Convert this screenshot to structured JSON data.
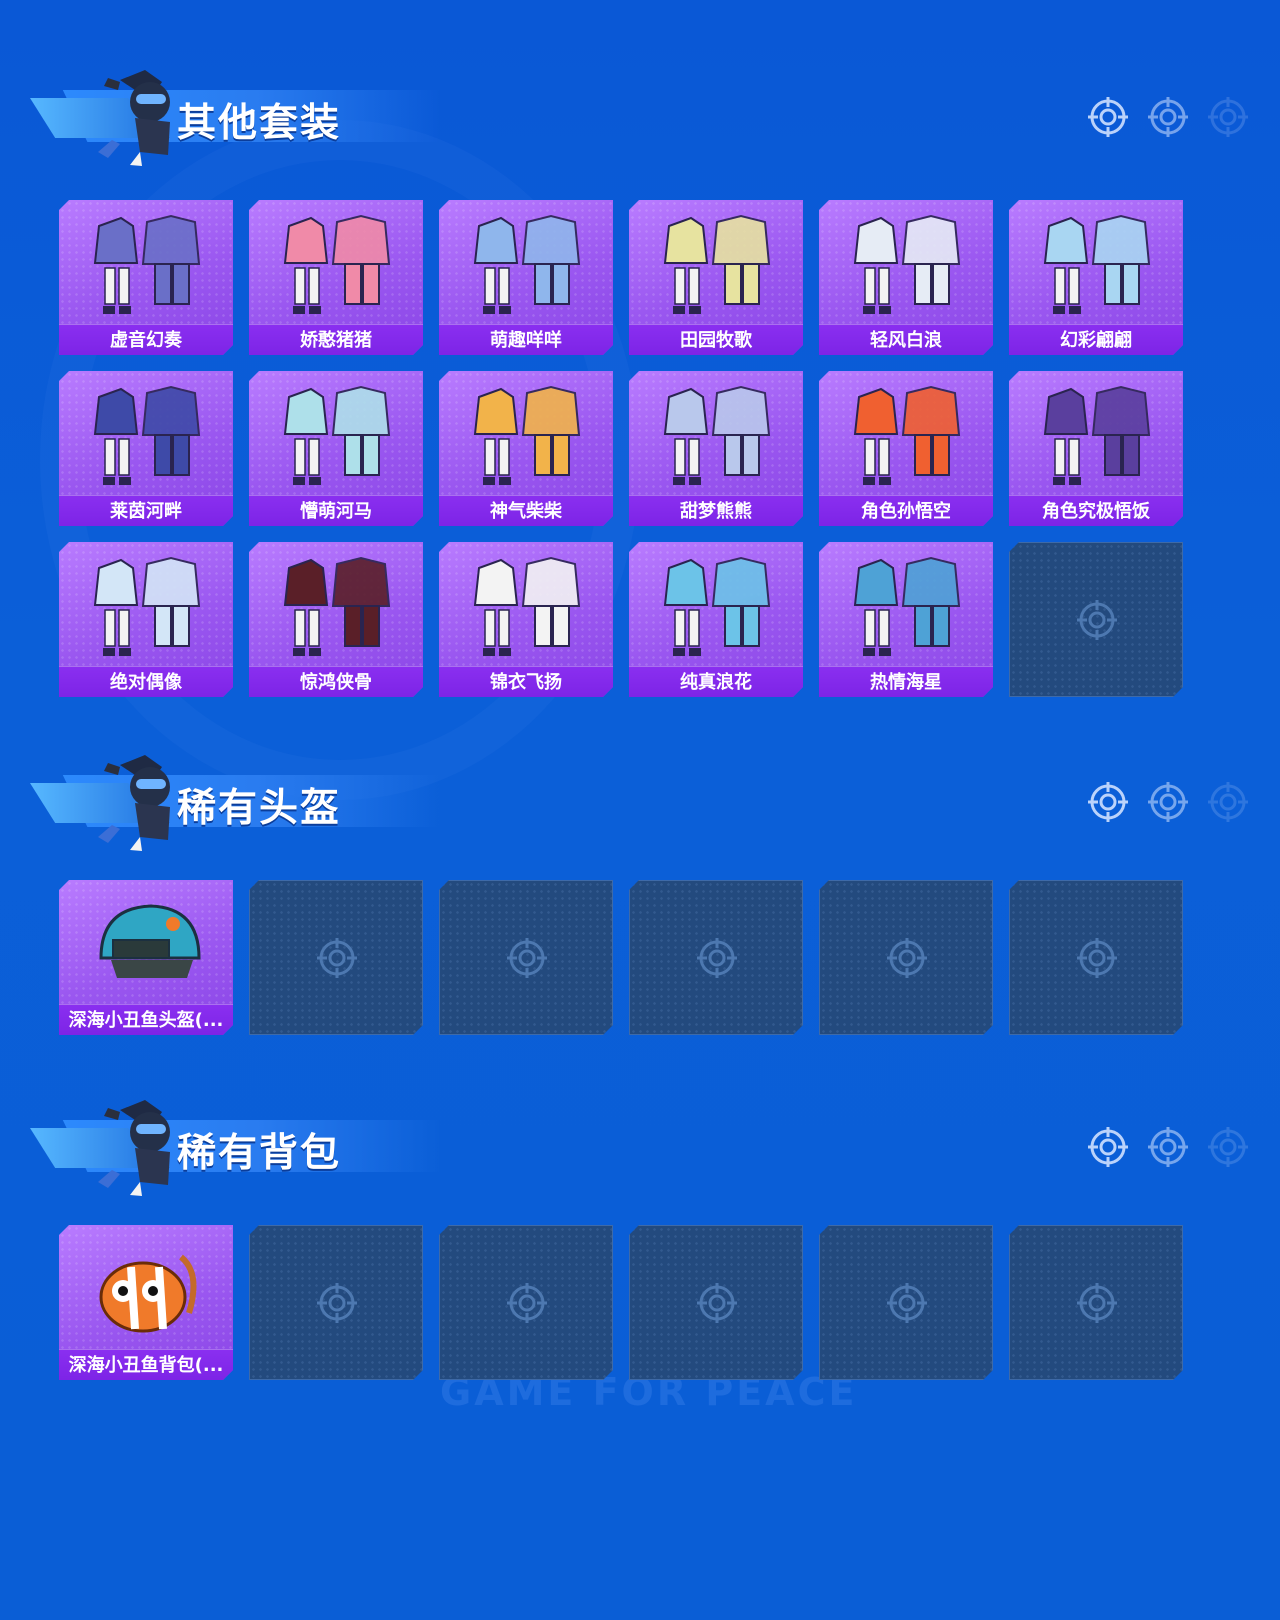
{
  "sections": [
    {
      "title": "其他套装",
      "items": [
        {
          "label": "虚音幻奏",
          "color": "#6a6fc8"
        },
        {
          "label": "娇憨猪猪",
          "color": "#f08aa8"
        },
        {
          "label": "萌趣咩咩",
          "color": "#8fb6ec"
        },
        {
          "label": "田园牧歌",
          "color": "#e7e3a0"
        },
        {
          "label": "轻风白浪",
          "color": "#e6ecf5"
        },
        {
          "label": "幻彩翩翩",
          "color": "#a9d6f2"
        },
        {
          "label": "莱茵河畔",
          "color": "#3e4aa8"
        },
        {
          "label": "懵萌河马",
          "color": "#aee0ea"
        },
        {
          "label": "神气柴柴",
          "color": "#f2b34a"
        },
        {
          "label": "甜梦熊熊",
          "color": "#b9c8ec"
        },
        {
          "label": "角色孙悟空",
          "color": "#f06030"
        },
        {
          "label": "角色究极悟饭",
          "color": "#5a3f9e"
        },
        {
          "label": "绝对偶像",
          "color": "#d3e6f7"
        },
        {
          "label": "惊鸿侠骨",
          "color": "#5a1f28"
        },
        {
          "label": "锦衣飞扬",
          "color": "#f3f3f3"
        },
        {
          "label": "纯真浪花",
          "color": "#6cc3e8"
        },
        {
          "label": "热情海星",
          "color": "#4ea2d6"
        }
      ],
      "empty_count": 1
    },
    {
      "title": "稀有头盔",
      "items": [
        {
          "label": "深海小丑鱼头盔(...",
          "color": "#2fa6c4"
        }
      ],
      "empty_count": 5
    },
    {
      "title": "稀有背包",
      "items": [
        {
          "label": "深海小丑鱼背包(...",
          "color": "#f07a2a"
        }
      ],
      "empty_count": 5
    }
  ]
}
